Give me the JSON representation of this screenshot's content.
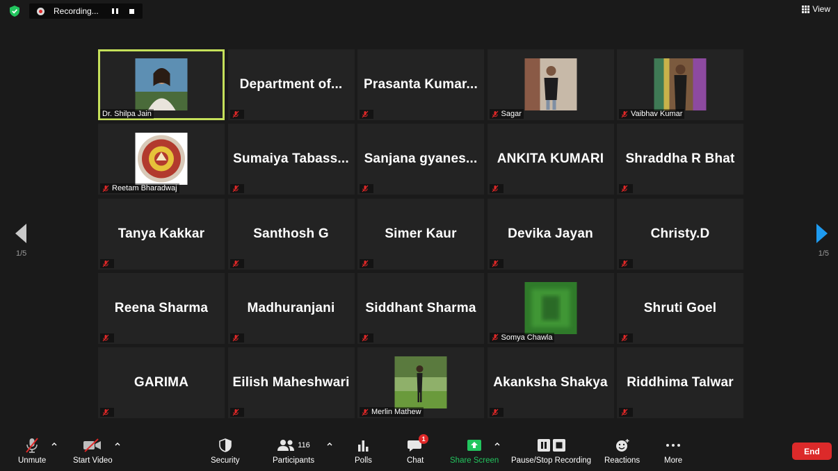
{
  "topbar": {
    "recording_label": "Recording...",
    "view_label": "View"
  },
  "navigation": {
    "page_left": "1/5",
    "page_right": "1/5"
  },
  "tiles": [
    {
      "name": "Dr. Shilpa Jain",
      "display": "photo",
      "label": "Dr. Shilpa Jain",
      "muted": false,
      "active": true
    },
    {
      "name": "Department of...",
      "display": "name",
      "label": "",
      "muted": true
    },
    {
      "name": "Prasanta Kumar...",
      "display": "name",
      "label": "",
      "muted": true
    },
    {
      "name": "Sagar",
      "display": "photo",
      "label": "Sagar",
      "muted": true
    },
    {
      "name": "Vaibhav Kumar",
      "display": "photo",
      "label": "Vaibhav Kumar",
      "muted": true
    },
    {
      "name": "Reetam Bharadwaj",
      "display": "photo",
      "label": "Reetam Bharadwaj",
      "muted": true
    },
    {
      "name": "Sumaiya Tabass...",
      "display": "name",
      "label": "",
      "muted": true
    },
    {
      "name": "Sanjana gyanes...",
      "display": "name",
      "label": "",
      "muted": true
    },
    {
      "name": "ANKITA KUMARI",
      "display": "name",
      "label": "",
      "muted": true
    },
    {
      "name": "Shraddha R Bhat",
      "display": "name",
      "label": "",
      "muted": true
    },
    {
      "name": "Tanya Kakkar",
      "display": "name",
      "label": "",
      "muted": true
    },
    {
      "name": "Santhosh G",
      "display": "name",
      "label": "",
      "muted": true
    },
    {
      "name": "Simer Kaur",
      "display": "name",
      "label": "",
      "muted": true
    },
    {
      "name": "Devika Jayan",
      "display": "name",
      "label": "",
      "muted": true
    },
    {
      "name": "Christy.D",
      "display": "name",
      "label": "",
      "muted": true
    },
    {
      "name": "Reena Sharma",
      "display": "name",
      "label": "",
      "muted": true
    },
    {
      "name": "Madhuranjani",
      "display": "name",
      "label": "",
      "muted": true
    },
    {
      "name": "Siddhant Sharma",
      "display": "name",
      "label": "",
      "muted": true
    },
    {
      "name": "Somya Chawla",
      "display": "photo",
      "label": "Somya Chawla",
      "muted": true
    },
    {
      "name": "Shruti Goel",
      "display": "name",
      "label": "",
      "muted": true
    },
    {
      "name": "GARIMA",
      "display": "name",
      "label": "",
      "muted": true
    },
    {
      "name": "Eilish Maheshwari",
      "display": "name",
      "label": "",
      "muted": true
    },
    {
      "name": "Merlin Mathew",
      "display": "photo",
      "label": "Merlin Mathew",
      "muted": true
    },
    {
      "name": "Akanksha Shakya",
      "display": "name",
      "label": "",
      "muted": true
    },
    {
      "name": "Riddhima Talwar",
      "display": "name",
      "label": "",
      "muted": true
    }
  ],
  "toolbar": {
    "unmute": "Unmute",
    "start_video": "Start Video",
    "security": "Security",
    "participants": "Participants",
    "participant_count": "116",
    "polls": "Polls",
    "chat": "Chat",
    "chat_badge": "1",
    "share_screen": "Share Screen",
    "pause_stop_recording": "Pause/Stop Recording",
    "reactions": "Reactions",
    "more": "More",
    "end": "End"
  },
  "colors": {
    "active_speaker_border": "#c5e05a",
    "share_green": "#22c55e",
    "end_red": "#dc2a2a",
    "tile_bg": "#232323",
    "nav_arrow_blue": "#1e9bf0"
  }
}
